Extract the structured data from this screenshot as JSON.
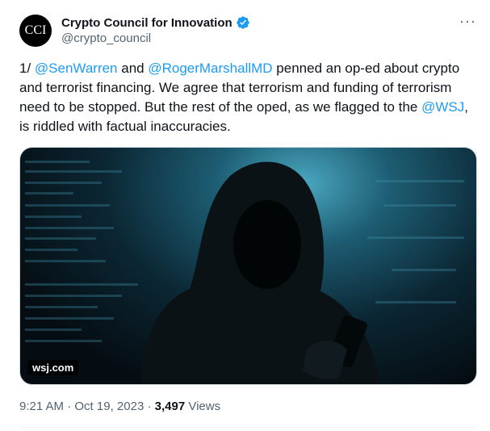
{
  "tweet": {
    "avatar_text": "CCI",
    "display_name": "Crypto Council for Innovation",
    "handle": "@crypto_council",
    "more_label": "···",
    "text_parts": {
      "p1": "1/ ",
      "m1": "@SenWarren",
      "p2": " and ",
      "m2": "@RogerMarshallMD",
      "p3": " penned an op-ed about crypto and terrorist financing. We agree that terrorism and funding of terrorism need to be stopped. But the rest of the oped, as we flagged to the ",
      "m3": "@WSJ",
      "p4": ", is riddled with factual inaccuracies."
    },
    "media_source": "wsj.com",
    "time": "9:21 AM",
    "date": "Oct 19, 2023",
    "views_count": "3,497",
    "views_label": "Views",
    "verified_color": "#1d9bf0",
    "link_color": "#1d9bf0"
  }
}
